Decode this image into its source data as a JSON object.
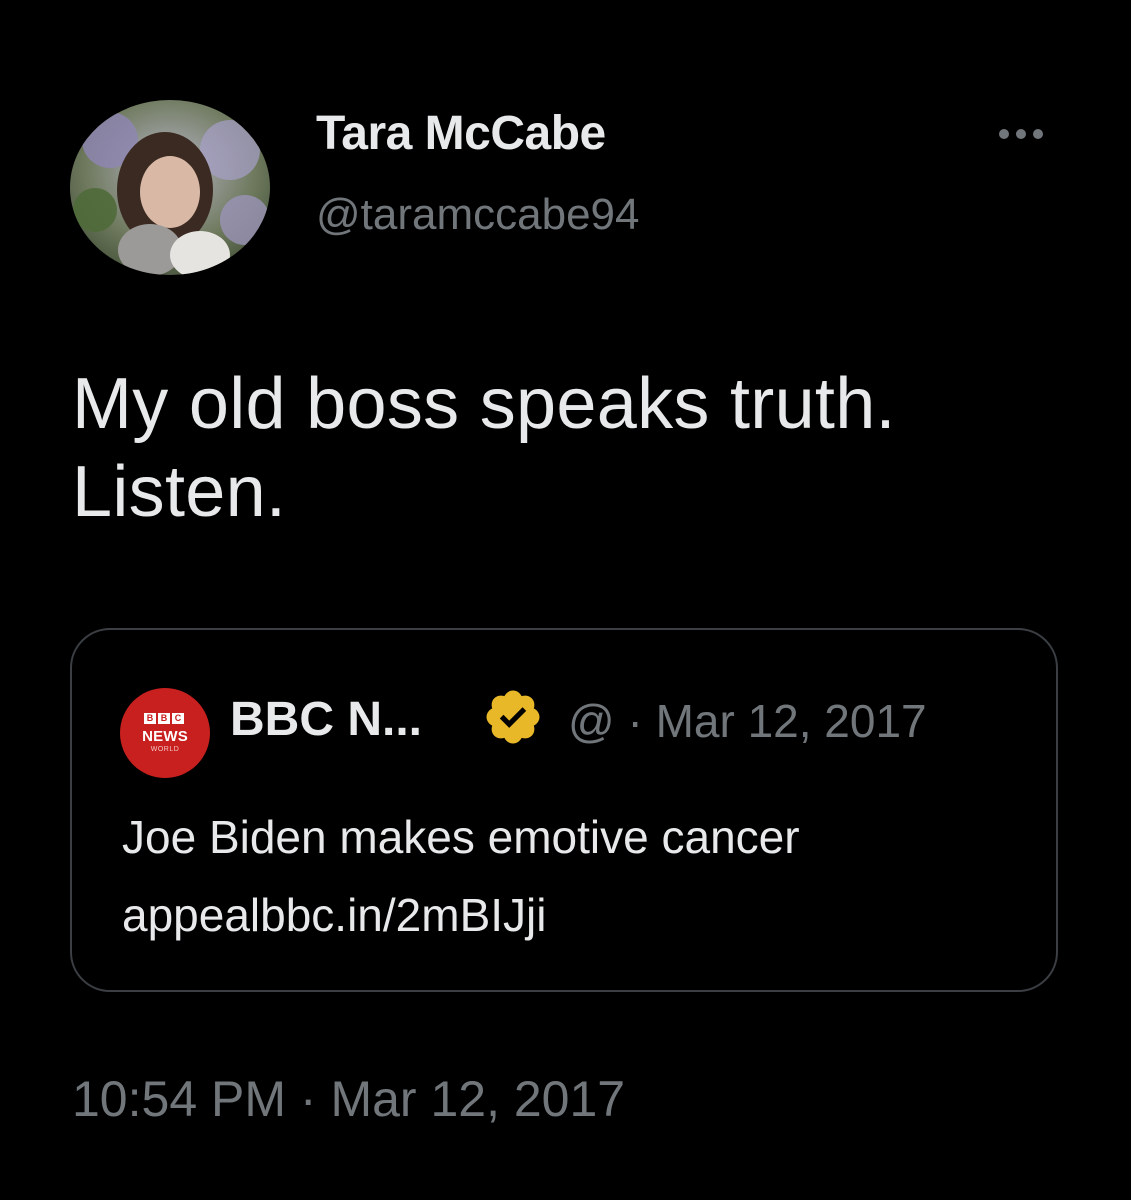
{
  "author": {
    "display_name": "Tara McCabe",
    "handle": "@taramccabe94"
  },
  "tweet": {
    "text": "My old boss speaks truth. Listen.",
    "timestamp": "10:54 PM · Mar 12, 2017"
  },
  "quoted_tweet": {
    "logo_lines": [
      "BBC",
      "NEWS",
      "WORLD"
    ],
    "display_name": "BBC N...",
    "meta": "@ · Mar 12, 2017",
    "text": "Joe Biden makes emotive cancer appealbbc.in/2mBIJji"
  },
  "icons": {
    "more": "more-horizontal-icon",
    "verified": "verified-badge-icon"
  },
  "colors": {
    "background": "#000000",
    "primary_text": "#e7e9ea",
    "secondary_text": "#71767b",
    "card_border": "#3b3f44",
    "verified_gold": "#e8b829",
    "bbc_red": "#c8201e"
  }
}
